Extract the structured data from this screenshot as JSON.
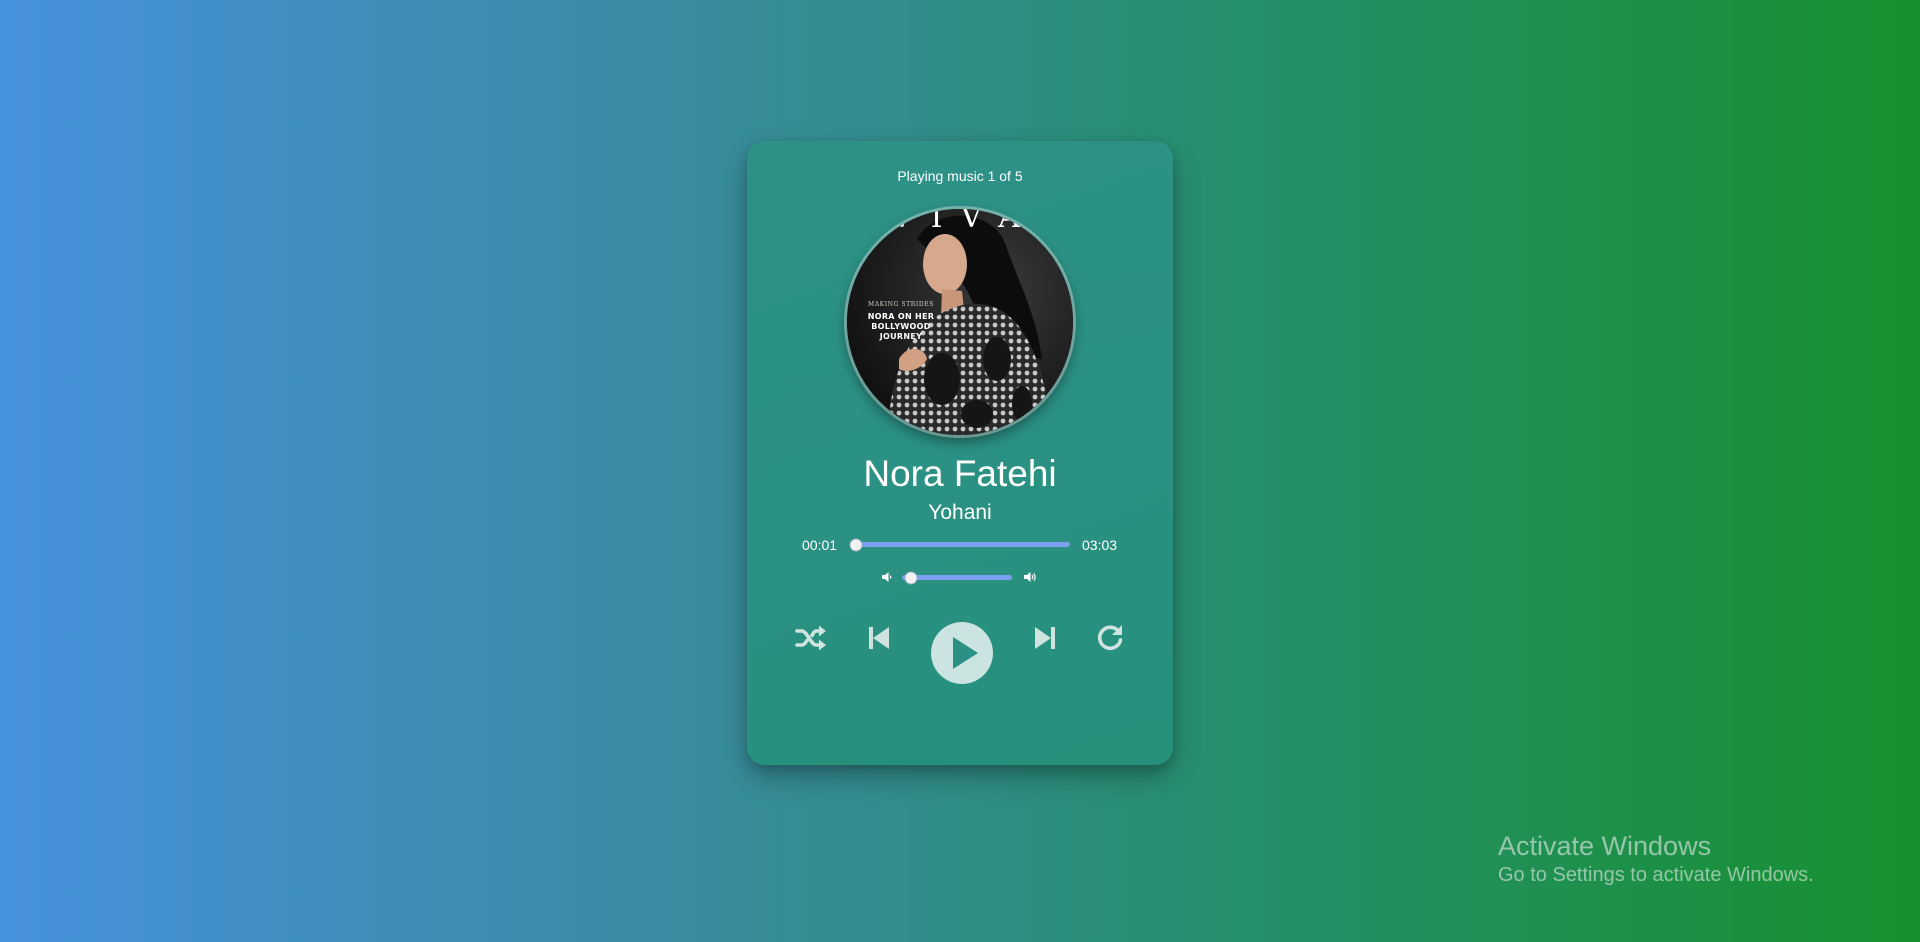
{
  "player": {
    "status_text": "Playing music 1 of 5",
    "cover": {
      "masthead": "VIVA",
      "kicker": "MAKING STRIDES",
      "headline": "NORA ON HER\nBOLLYWOOD\nJOURNEY"
    },
    "title": "Nora Fatehi",
    "artist": "Yohani",
    "current_time": "00:01",
    "total_time": "03:03",
    "progress_fraction": 0.005,
    "volume_fraction": 0.08,
    "controls": {
      "shuffle_icon": "shuffle-icon",
      "prev_icon": "skip-back-icon",
      "play_icon": "play-icon",
      "next_icon": "skip-forward-icon",
      "repeat_icon": "repeat-icon"
    }
  },
  "colors": {
    "card": "#2b9184",
    "progress_track": "#7d9ff0",
    "play_button": "#cce4e1",
    "control_icon": "#cfe3df"
  },
  "watermark": {
    "title": "Activate Windows",
    "subtitle": "Go to Settings to activate Windows."
  }
}
